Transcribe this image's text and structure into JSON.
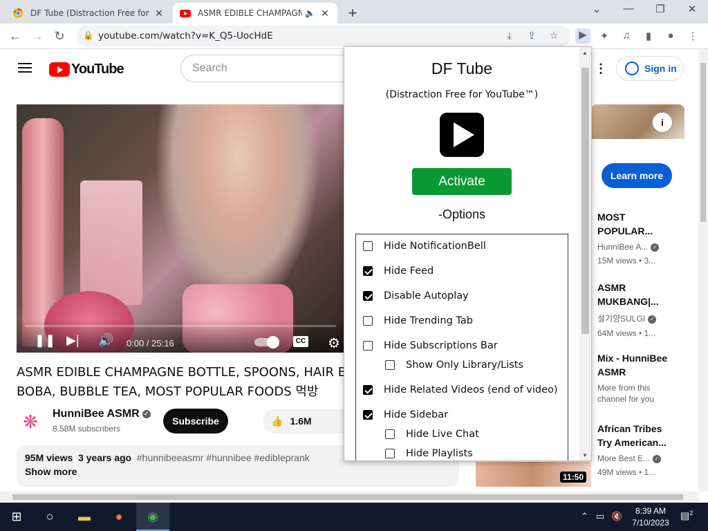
{
  "browser": {
    "tabs": [
      {
        "title": "DF Tube (Distraction Free for You",
        "favicon": "df-tube-favicon",
        "active": false
      },
      {
        "title": "ASMR EDIBLE CHAMPAGNE",
        "favicon": "youtube-favicon",
        "active": true
      }
    ],
    "url": "youtube.com/watch?v=K_Q5-UocHdE"
  },
  "youtube": {
    "logo_text": "YouTube",
    "search_placeholder": "Search",
    "sign_in": "Sign in",
    "player": {
      "time": "0:00 / 25:16"
    },
    "video_title_line1": "ASMR EDIBLE CHAMPAGNE BOTTLE, SPOONS, HAIR B",
    "video_title_line2": "BOBA, BUBBLE TEA, MOST POPULAR FOODS 먹방",
    "channel_name": "HunniBee ASMR",
    "subscribers": "8.58M subscribers",
    "subscribe_label": "Subscribe",
    "likes": "1.6M",
    "views": "95M views",
    "age": "3 years ago",
    "tags": "#hunnibeeasmr #hunnibee #edibleprank",
    "show_more": "Show more",
    "learn_more": "Learn more",
    "related": [
      {
        "title1": "MOST",
        "title2": "POPULAR...",
        "channel": "HunniBee A...",
        "stats": "15M views • 3..."
      },
      {
        "title1": "ASMR",
        "title2": "MUKBANG|...",
        "channel": "설기양SULGI",
        "stats": "64M views • 1..."
      },
      {
        "title1": "Mix - HunniBee",
        "title2": "ASMR",
        "channel": "More from this",
        "stats": "channel for you"
      },
      {
        "title1": "African Tribes",
        "title2": "Try American...",
        "channel": "More Best E...",
        "stats": "49M views • 1..."
      }
    ],
    "duration_badge": "11:50"
  },
  "popup": {
    "title": "DF Tube",
    "subtitle": "(Distraction Free for YouTube™)",
    "activate": "Activate",
    "options_heading": "-Options",
    "options": [
      {
        "label": "Hide NotificationBell",
        "checked": false,
        "indent": false
      },
      {
        "label": "Hide Feed",
        "checked": true,
        "indent": false
      },
      {
        "label": "Disable Autoplay",
        "checked": true,
        "indent": false
      },
      {
        "label": "Hide Trending Tab",
        "checked": false,
        "indent": false
      },
      {
        "label": "Hide Subscriptions Bar",
        "checked": false,
        "indent": false
      },
      {
        "label": "Show Only Library/Lists",
        "checked": false,
        "indent": true
      },
      {
        "label": "Hide Related Videos (end of video)",
        "checked": true,
        "indent": false
      },
      {
        "label": "Hide Sidebar",
        "checked": true,
        "indent": false
      },
      {
        "label": "Hide Live Chat",
        "checked": false,
        "indent": true
      },
      {
        "label": "Hide Playlists",
        "checked": false,
        "indent": true
      }
    ]
  },
  "taskbar": {
    "time": "8:39 AM",
    "date": "7/10/2023",
    "notifications": "2"
  },
  "colors": {
    "activate": "#0a9a34",
    "youtube_red": "#ff0000",
    "link_blue": "#065fd4"
  }
}
